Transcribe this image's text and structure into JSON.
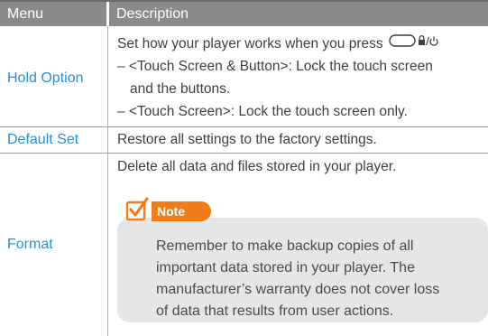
{
  "header": {
    "menu": "Menu",
    "description": "Description"
  },
  "rows": {
    "hold": {
      "menu": "Hold Option",
      "lines": [
        "Set how your player works when you press",
        "– <Touch Screen & Button>: Lock the touch screen",
        "and the buttons.",
        "– <Touch Screen>: Lock the touch screen only."
      ],
      "button_glyph": "hold-power-icon"
    },
    "default": {
      "menu": "Default Set",
      "text": "Restore all settings to the factory settings."
    },
    "format": {
      "menu": "Format",
      "text": "Delete all data and files stored in your player.",
      "note": {
        "label": "Note",
        "icon": "note-checkbox-icon",
        "lines": [
          "Remember to make backup copies of all",
          "important data stored in your player. The",
          "manufacturer’s warranty does not cover loss",
          "of data that results from user actions."
        ]
      }
    }
  },
  "colors": {
    "accent": "#2a8fd6",
    "note_badge": "#ef7d1a",
    "header_bg": "#8a8a8a",
    "note_bg": "#e6e6e6"
  }
}
